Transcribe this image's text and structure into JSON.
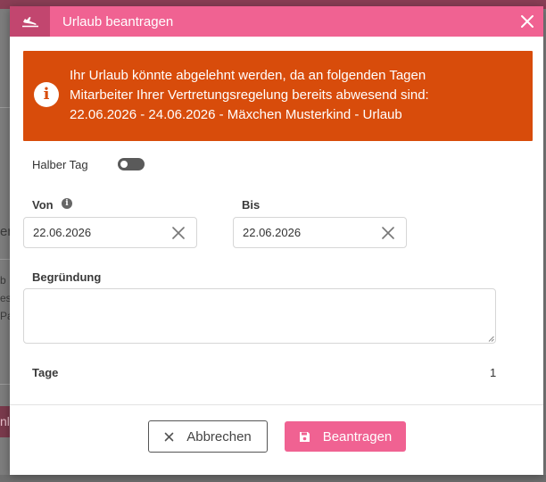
{
  "background": {
    "side_texts": [
      "er",
      "b",
      "es",
      "Pa",
      "nl"
    ]
  },
  "dialog": {
    "title": "Urlaub beantragen",
    "header_icon": "airplane-icon",
    "close_icon": "close-icon",
    "alert": {
      "icon": "info-icon",
      "lines": [
        "Ihr Urlaub könnte abgelehnt werden, da an folgenden Tagen",
        "Mitarbeiter Ihrer Vertretungsregelung bereits abwesend sind:",
        "22.06.2026 - 24.06.2026 - Mäxchen Musterkind - Urlaub"
      ]
    },
    "half_day": {
      "label": "Halber Tag",
      "enabled": false
    },
    "from": {
      "label": "Von",
      "value": "22.06.2026",
      "info_icon": "info-icon"
    },
    "to": {
      "label": "Bis",
      "value": "22.06.2026"
    },
    "reason": {
      "label": "Begründung",
      "value": ""
    },
    "days": {
      "label": "Tage",
      "value": "1"
    },
    "buttons": {
      "cancel": {
        "label": "Abbrechen",
        "icon": "close-icon"
      },
      "submit": {
        "label": "Beantragen",
        "icon": "save-icon"
      }
    }
  },
  "colors": {
    "accent": "#f06292",
    "accent_dark": "#c2466f",
    "warning": "#d84c0b"
  }
}
